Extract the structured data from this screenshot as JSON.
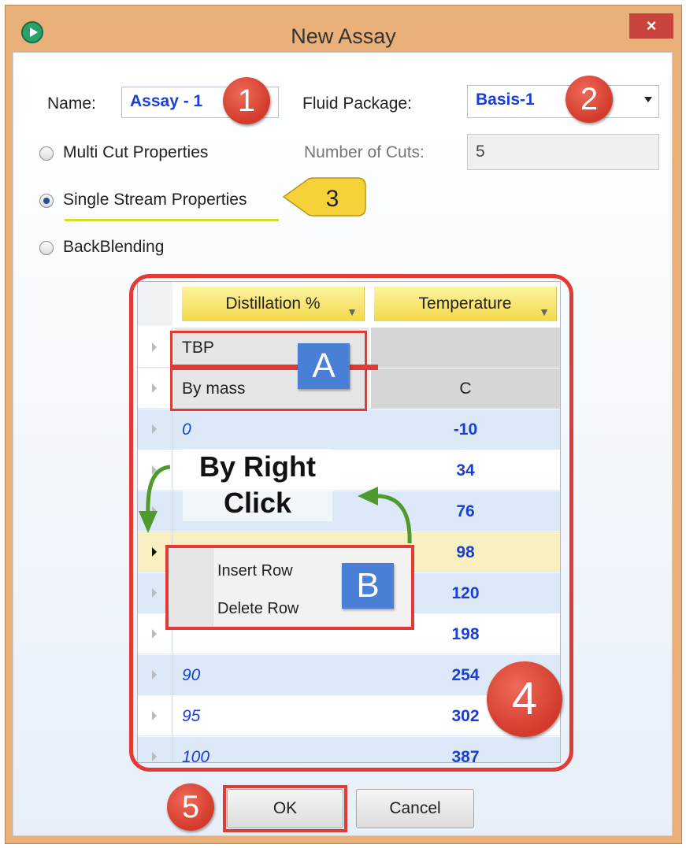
{
  "window": {
    "title": "New Assay",
    "close_glyph": "×"
  },
  "form": {
    "name_label": "Name:",
    "name_value": "Assay - 1",
    "fluid_package_label": "Fluid Package:",
    "fluid_package_value": "Basis-1",
    "number_of_cuts_label": "Number of Cuts:",
    "number_of_cuts_value": "5",
    "options": [
      {
        "label": "Multi Cut Properties",
        "selected": false
      },
      {
        "label": "Single Stream Properties",
        "selected": true
      },
      {
        "label": "BackBlending",
        "selected": false
      }
    ]
  },
  "grid": {
    "columns": [
      "Distillation %",
      "Temperature"
    ],
    "rows": [
      {
        "c1": "TBP",
        "c2": ""
      },
      {
        "c1": "By mass",
        "c2": "C"
      },
      {
        "c1": "0",
        "c2": "-10"
      },
      {
        "c1": "",
        "c2": "34"
      },
      {
        "c1": "",
        "c2": "76"
      },
      {
        "c1": "",
        "c2": "98"
      },
      {
        "c1": "",
        "c2": "120"
      },
      {
        "c1": "",
        "c2": "198"
      },
      {
        "c1": "90",
        "c2": "254"
      },
      {
        "c1": "95",
        "c2": "302"
      },
      {
        "c1": "100",
        "c2": "387"
      }
    ]
  },
  "context_menu": {
    "items": [
      "Insert Row",
      "Delete Row"
    ]
  },
  "annotations": {
    "badge_1": "1",
    "badge_2": "2",
    "badge_3": "3",
    "badge_4": "4",
    "badge_5": "5",
    "box_a": "A",
    "box_b": "B",
    "right_click_line1": "By Right",
    "right_click_line2": "Click"
  },
  "buttons": {
    "ok": "OK",
    "cancel": "Cancel"
  },
  "colors": {
    "frame": "#e9b179",
    "close": "#c7433b",
    "badge": "#d23a2b",
    "highlight_box": "#e23a34",
    "label_box": "#4a7fd6",
    "value_text": "#1a3fd6"
  }
}
